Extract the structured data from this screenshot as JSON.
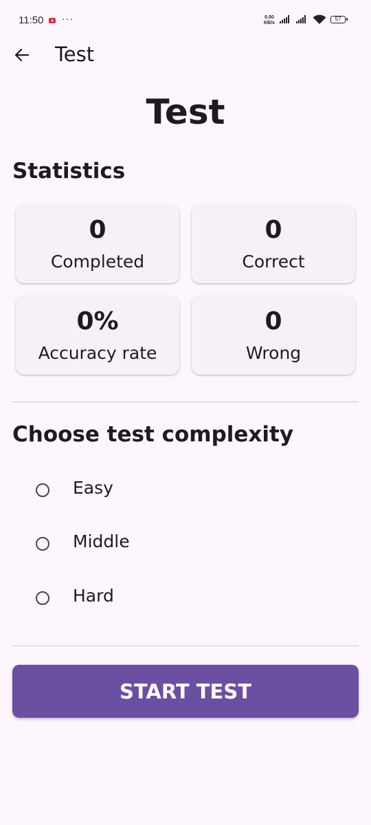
{
  "status_bar": {
    "time": "11:50",
    "more": "···",
    "net_speed_value": "0.00",
    "net_speed_unit": "KB/s",
    "battery": "57",
    "icons": [
      "youtube-notification-icon",
      "signal-icon",
      "wifi-icon",
      "battery-icon"
    ]
  },
  "app_bar": {
    "title": "Test",
    "back_icon": "arrow-left-icon"
  },
  "page": {
    "title": "Test"
  },
  "statistics": {
    "title": "Statistics",
    "cards": [
      {
        "value": "0",
        "label": "Completed"
      },
      {
        "value": "0",
        "label": "Correct"
      },
      {
        "value": "0%",
        "label": "Accuracy rate"
      },
      {
        "value": "0",
        "label": "Wrong"
      }
    ]
  },
  "complexity": {
    "title": "Choose test complexity",
    "options": [
      {
        "label": "Easy",
        "selected": false
      },
      {
        "label": "Middle",
        "selected": false
      },
      {
        "label": "Hard",
        "selected": false
      }
    ]
  },
  "actions": {
    "start_label": "START TEST"
  },
  "colors": {
    "background": "#fdf7fd",
    "card_background": "#f6f1f8",
    "primary": "#6a4fa3",
    "text": "#1d1b20",
    "divider": "#cac4d0"
  }
}
